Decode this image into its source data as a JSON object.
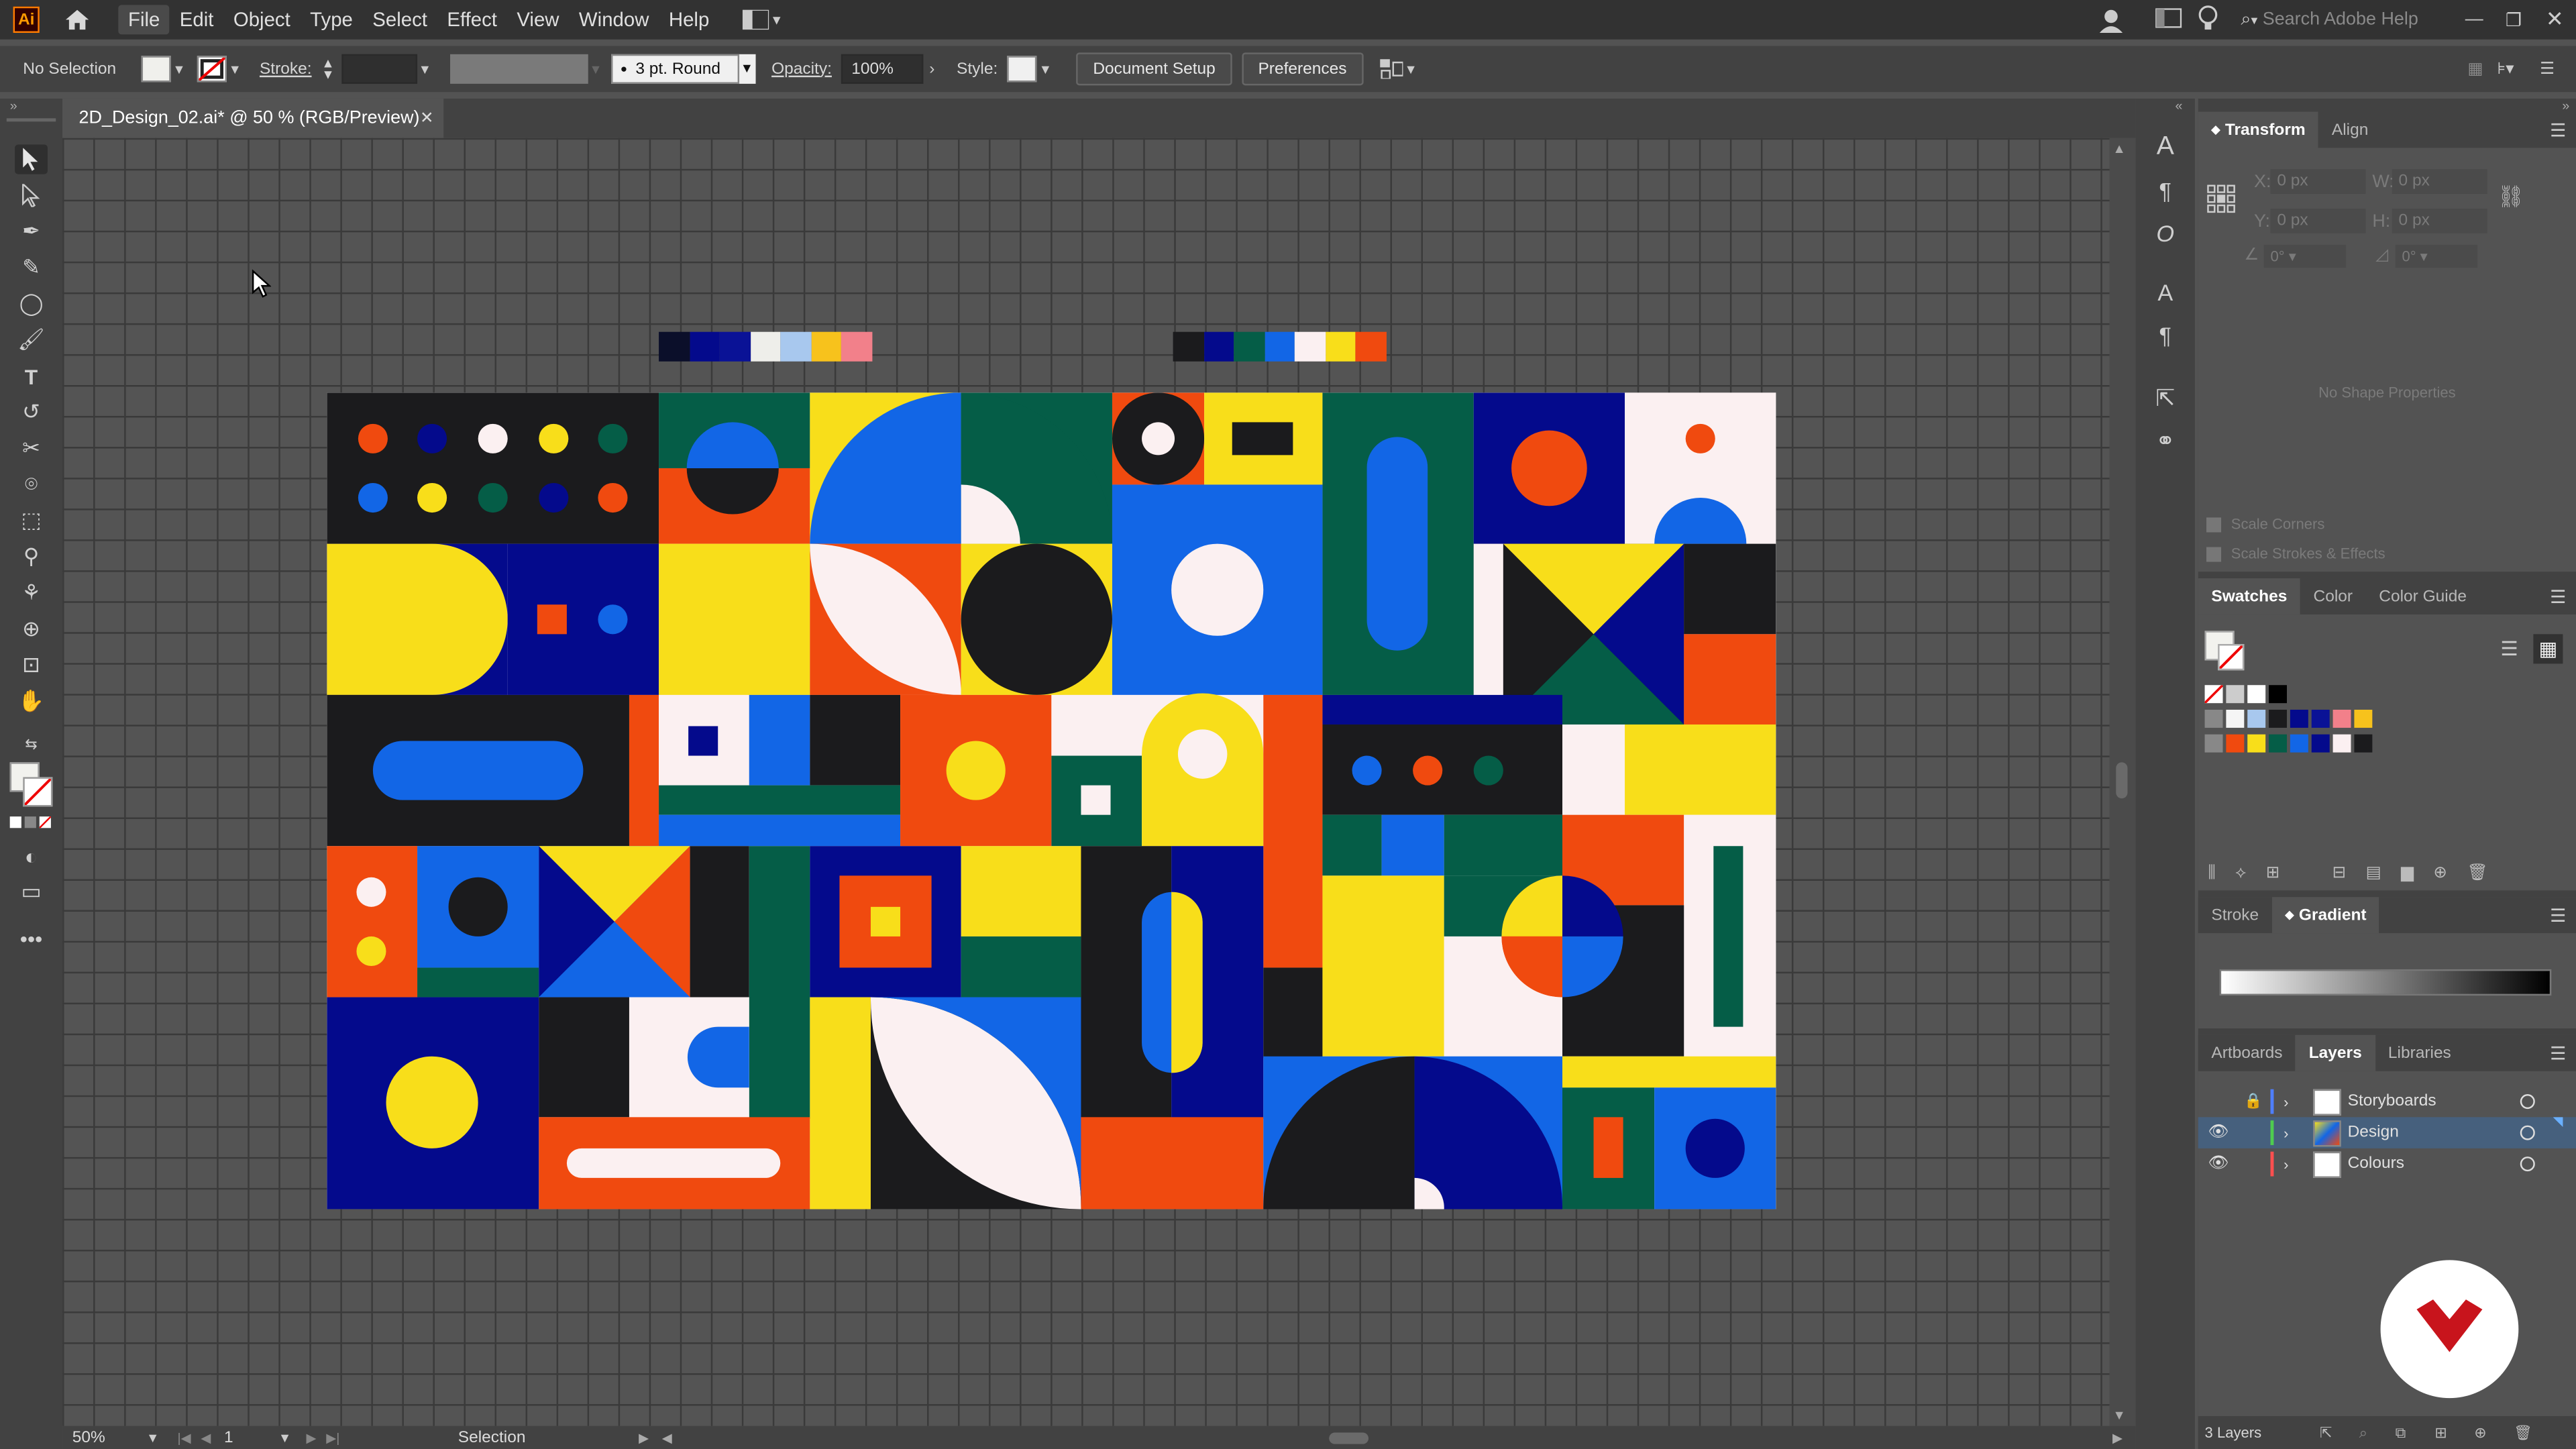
{
  "app": {
    "logo_text": "Ai"
  },
  "menu": {
    "items": [
      "File",
      "Edit",
      "Object",
      "Type",
      "Select",
      "Effect",
      "View",
      "Window",
      "Help"
    ]
  },
  "topright": {
    "search_placeholder": "Search Adobe Help"
  },
  "control": {
    "selection": "No Selection",
    "stroke_label": "Stroke:",
    "brush": "3 pt. Round",
    "opacity_label": "Opacity:",
    "opacity_value": "100%",
    "style_label": "Style:",
    "document_setup": "Document Setup",
    "preferences": "Preferences"
  },
  "document": {
    "tab_title": "2D_Design_02.ai* @ 50 % (RGB/Preview)"
  },
  "status": {
    "zoom": "50%",
    "artboard": "1",
    "tool": "Selection"
  },
  "transform": {
    "tabs": [
      "Transform",
      "Align"
    ],
    "x_label": "X:",
    "x_value": "0 px",
    "y_label": "Y:",
    "y_value": "0 px",
    "w_label": "W:",
    "w_value": "0 px",
    "h_label": "H:",
    "h_value": "0 px",
    "angle": "0°",
    "shear": "0°",
    "no_shape": "No Shape Properties",
    "scale_corners": "Scale Corners",
    "scale_strokes": "Scale Strokes & Effects"
  },
  "swatches": {
    "tabs": [
      "Swatches",
      "Color",
      "Color Guide"
    ]
  },
  "gradient": {
    "tabs": [
      "Stroke",
      "Gradient"
    ]
  },
  "layers": {
    "tabs": [
      "Artboards",
      "Layers",
      "Libraries"
    ],
    "items": [
      {
        "name": "Storyboards",
        "color": "#4f7fff"
      },
      {
        "name": "Design",
        "color": "#4fcc4f"
      },
      {
        "name": "Colours",
        "color": "#ff4f4f"
      }
    ],
    "count": "3 Layers"
  },
  "palette": {
    "colors": {
      "black": "#1b1b1d",
      "navy": "#040a8c",
      "blue": "#1266e6",
      "green": "#055d47",
      "yellow": "#f8de1a",
      "orange": "#f04a0f",
      "white": "#fbf0f1",
      "pink": "#f2808a",
      "lightblue": "#a8c8ee"
    }
  }
}
